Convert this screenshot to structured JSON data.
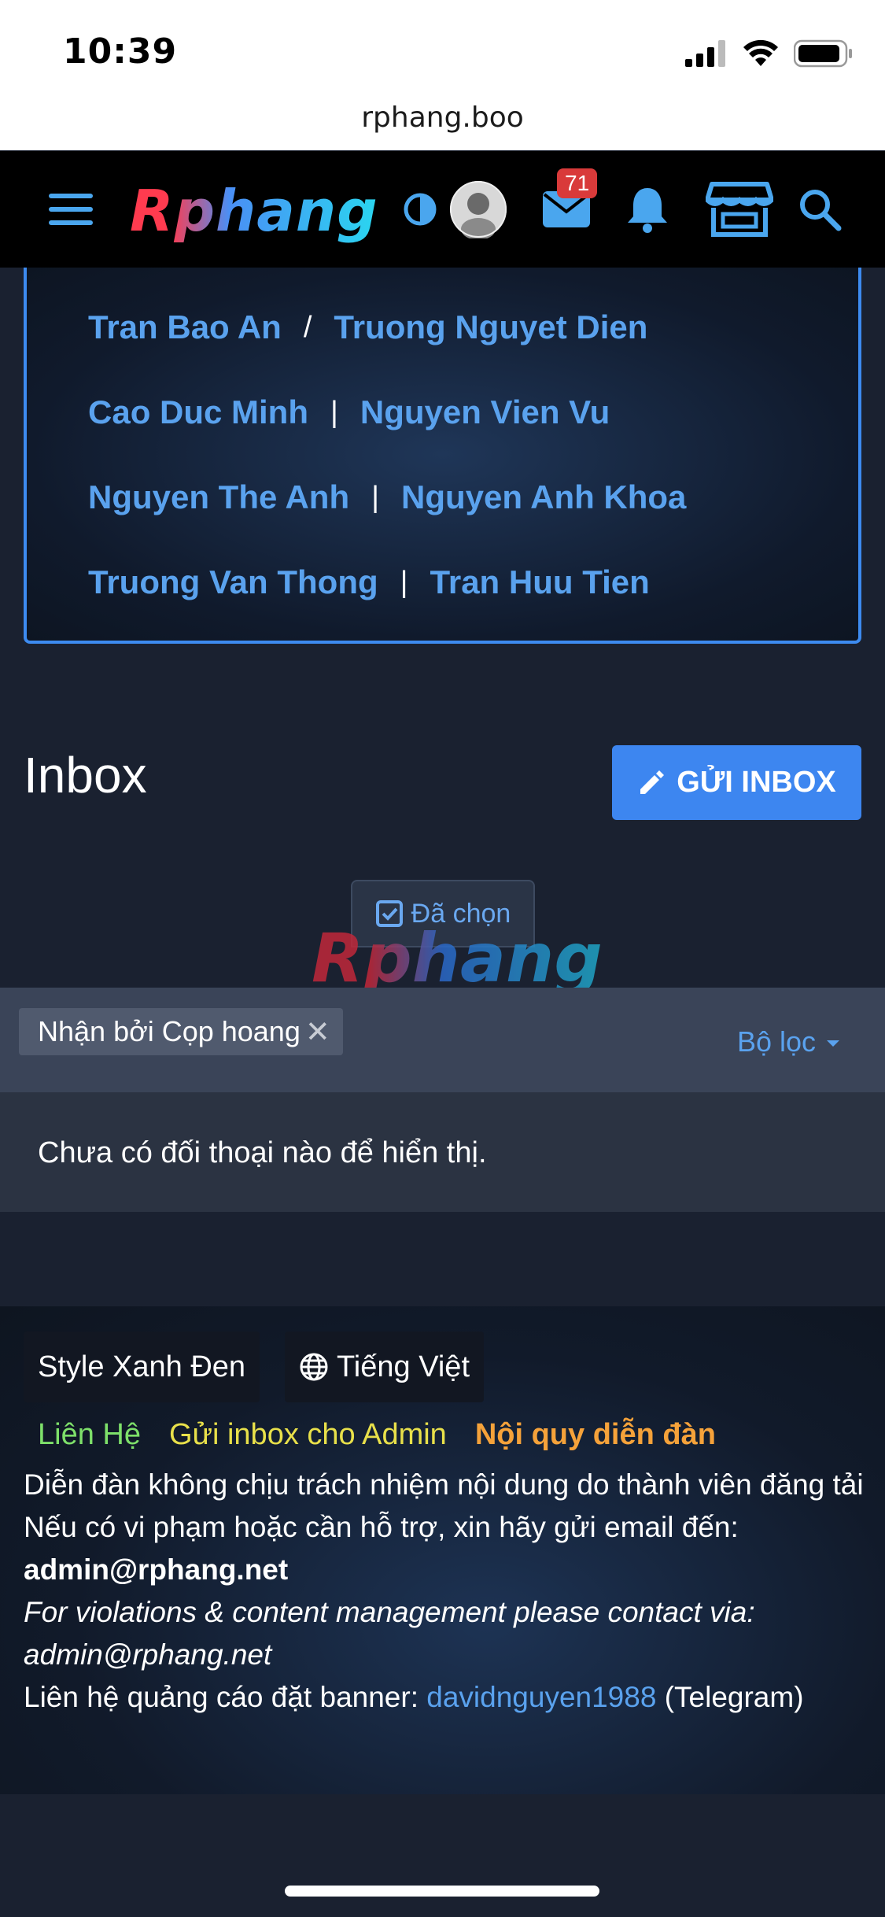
{
  "status_bar": {
    "time": "10:39"
  },
  "browser": {
    "url": "rphang.boo"
  },
  "header": {
    "logo": "Rphang",
    "inbox_badge": "71",
    "accent": "#3d86f0"
  },
  "names": [
    {
      "a": "Tran Bao An",
      "sep": "/",
      "b": "Truong Nguyet Dien"
    },
    {
      "a": "Cao Duc Minh",
      "sep": "|",
      "b": "Nguyen Vien Vu"
    },
    {
      "a": "Nguyen The Anh",
      "sep": "|",
      "b": "Nguyen Anh Khoa"
    },
    {
      "a": "Truong Van Thong",
      "sep": "|",
      "b": "Tran Huu Tien"
    }
  ],
  "page": {
    "title": "Inbox",
    "send_button": "GỬI INBOX",
    "selected_button": "Đã chọn",
    "watermark": "Rphang"
  },
  "filter": {
    "chip": "Nhận bởi Cọp hoang",
    "menu_label": "Bộ lọc"
  },
  "empty_message": "Chưa có đối thoại nào để hiển thị.",
  "footer": {
    "style_button": "Style Xanh Đen",
    "language_button": "Tiếng Việt",
    "links": [
      {
        "label": "Liên Hệ",
        "color": "#7ee06a"
      },
      {
        "label": "Gửi inbox cho Admin",
        "color": "#e8e04a"
      },
      {
        "label": "Nội quy diễn đàn",
        "color": "#f5a23a"
      }
    ],
    "disclaimer": "Diễn đàn không chịu trách nhiệm nội dung do thành viên đăng tải",
    "contact_line": "Nếu có vi phạm hoặc cần hỗ trợ, xin hãy gửi email đến:",
    "contact_email": "admin@rphang.net",
    "english_note": "For violations & content management please contact via: admin@rphang.net",
    "ads_prefix": "Liên hệ quảng cáo đặt banner:",
    "ads_handle": "davidnguyen1988",
    "ads_suffix": "(Telegram)"
  }
}
